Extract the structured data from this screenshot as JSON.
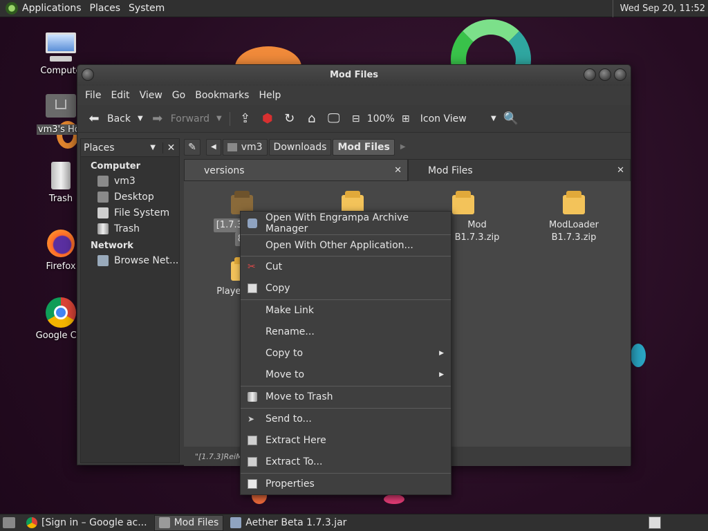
{
  "top_panel": {
    "menus": [
      "Applications",
      "Places",
      "System"
    ],
    "clock": "Wed Sep 20, 11:52"
  },
  "desktop_icons": [
    {
      "label": "Compute",
      "icon": "computer-icon"
    },
    {
      "label": "vm3's Hor",
      "icon": "home-folder-icon"
    },
    {
      "label": "Trash",
      "icon": "trash-icon"
    },
    {
      "label": "Firefox",
      "icon": "firefox-icon"
    },
    {
      "label": "Google Chr",
      "icon": "chrome-icon"
    }
  ],
  "window": {
    "title": "Mod Files",
    "menubar": [
      "File",
      "Edit",
      "View",
      "Go",
      "Bookmarks",
      "Help"
    ],
    "toolbar": {
      "back": "Back",
      "forward": "Forward",
      "zoom": "100%",
      "view_mode": "Icon View"
    },
    "sidebar": {
      "header": "Places",
      "sections": [
        {
          "title": "Computer",
          "items": [
            "vm3",
            "Desktop",
            "File System",
            "Trash"
          ]
        },
        {
          "title": "Network",
          "items": [
            "Browse Net..."
          ]
        }
      ]
    },
    "breadcrumbs": [
      "vm3",
      "Downloads",
      "Mod Files"
    ],
    "tabs": [
      {
        "label": "versions",
        "active": false
      },
      {
        "label": "Mod Files",
        "active": true
      }
    ],
    "files": [
      {
        "label": "[1.7.3]ReiM",
        "label2": "8.",
        "selected": true
      },
      {
        "label": "",
        "selected": false
      },
      {
        "label": "Mod B1.7.3.zip",
        "selected": false
      },
      {
        "label": "ModLoader B1.7.3.zip",
        "selected": false
      },
      {
        "label": "PlayerAPI 1",
        "selected": false
      }
    ],
    "status": "\"[1.7.3]ReiMi"
  },
  "context_menu": [
    {
      "label": "Open With Engrampa Archive Manager",
      "icon": "archive-manager-icon"
    },
    {
      "label": "Open With Other Application...",
      "icon": ""
    },
    {
      "label": "Cut",
      "icon": "scissors-icon"
    },
    {
      "label": "Copy",
      "icon": "copy-icon"
    },
    {
      "label": "Make Link",
      "icon": ""
    },
    {
      "label": "Rename...",
      "icon": ""
    },
    {
      "label": "Copy to",
      "icon": "",
      "submenu": true
    },
    {
      "label": "Move to",
      "icon": "",
      "submenu": true
    },
    {
      "label": "Move to Trash",
      "icon": "trash-icon"
    },
    {
      "label": "Send to...",
      "icon": "send-icon"
    },
    {
      "label": "Extract Here",
      "icon": "extract-icon"
    },
    {
      "label": "Extract To...",
      "icon": "extract-icon"
    },
    {
      "label": "Properties",
      "icon": "properties-icon"
    }
  ],
  "taskbar": [
    {
      "label": "[Sign in – Google ac...",
      "icon": "chrome-icon",
      "active": false
    },
    {
      "label": "Mod Files",
      "icon": "folder-icon",
      "active": true
    },
    {
      "label": "Aether Beta 1.7.3.jar",
      "icon": "archive-manager-icon",
      "active": false
    }
  ],
  "colors": {
    "panel": "#303030",
    "window_bg": "#3c3c3c",
    "content_bg": "#474747",
    "package": "#f3c35a",
    "selected_package": "#8a6a3a"
  }
}
